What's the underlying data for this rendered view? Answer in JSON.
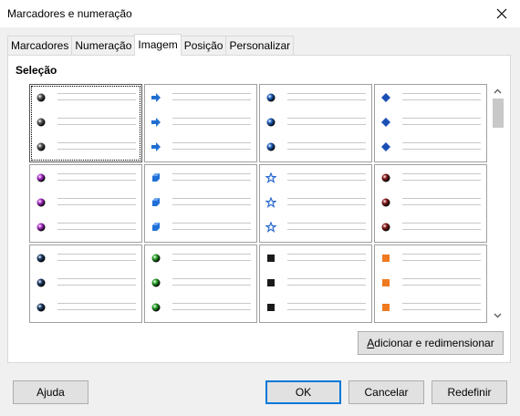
{
  "window": {
    "title": "Marcadores e numeração",
    "close_icon": "close-icon"
  },
  "tabs": [
    {
      "label": "Marcadores",
      "active": false
    },
    {
      "label": "Numeração",
      "active": false
    },
    {
      "label": "Imagem",
      "active": true
    },
    {
      "label": "Posição",
      "active": false
    },
    {
      "label": "Personalizar",
      "active": false
    }
  ],
  "selection": {
    "label": "Seleção",
    "selected_index": 0,
    "bullets": [
      {
        "icon": "gray-sphere-bullet",
        "color": "#5a5a5a",
        "shape": "sphere"
      },
      {
        "icon": "blue-arrow-bullet",
        "color": "#1f6fd1",
        "shape": "arrow"
      },
      {
        "icon": "blue-sphere-bullet",
        "color": "#1e5fbf",
        "shape": "sphere"
      },
      {
        "icon": "blue-diamond-bullet",
        "color": "#1a4fb5",
        "shape": "diamond"
      },
      {
        "icon": "purple-sphere-bullet",
        "color": "#b030d0",
        "shape": "sphere"
      },
      {
        "icon": "blue-cube-bullet",
        "color": "#2070d8",
        "shape": "cube"
      },
      {
        "icon": "blue-star-bullet",
        "color": "#2a6ad0",
        "shape": "star"
      },
      {
        "icon": "darkred-sphere-bullet",
        "color": "#8b1a1a",
        "shape": "sphere"
      },
      {
        "icon": "navy-sphere-bullet",
        "color": "#1e3f6e",
        "shape": "sphere"
      },
      {
        "icon": "green-sphere-bullet",
        "color": "#2aa52a",
        "shape": "sphere"
      },
      {
        "icon": "black-square-bullet",
        "color": "#1a1a1a",
        "shape": "square"
      },
      {
        "icon": "orange-square-bullet",
        "color": "#f07a20",
        "shape": "square"
      }
    ]
  },
  "buttons": {
    "resize": "Adicionar e redimensionar",
    "help": "Ajuda",
    "ok": "OK",
    "cancel": "Cancelar",
    "reset": "Redefinir"
  },
  "scrollbar": {
    "up_icon": "scroll-up-icon",
    "down_icon": "scroll-down-icon"
  }
}
